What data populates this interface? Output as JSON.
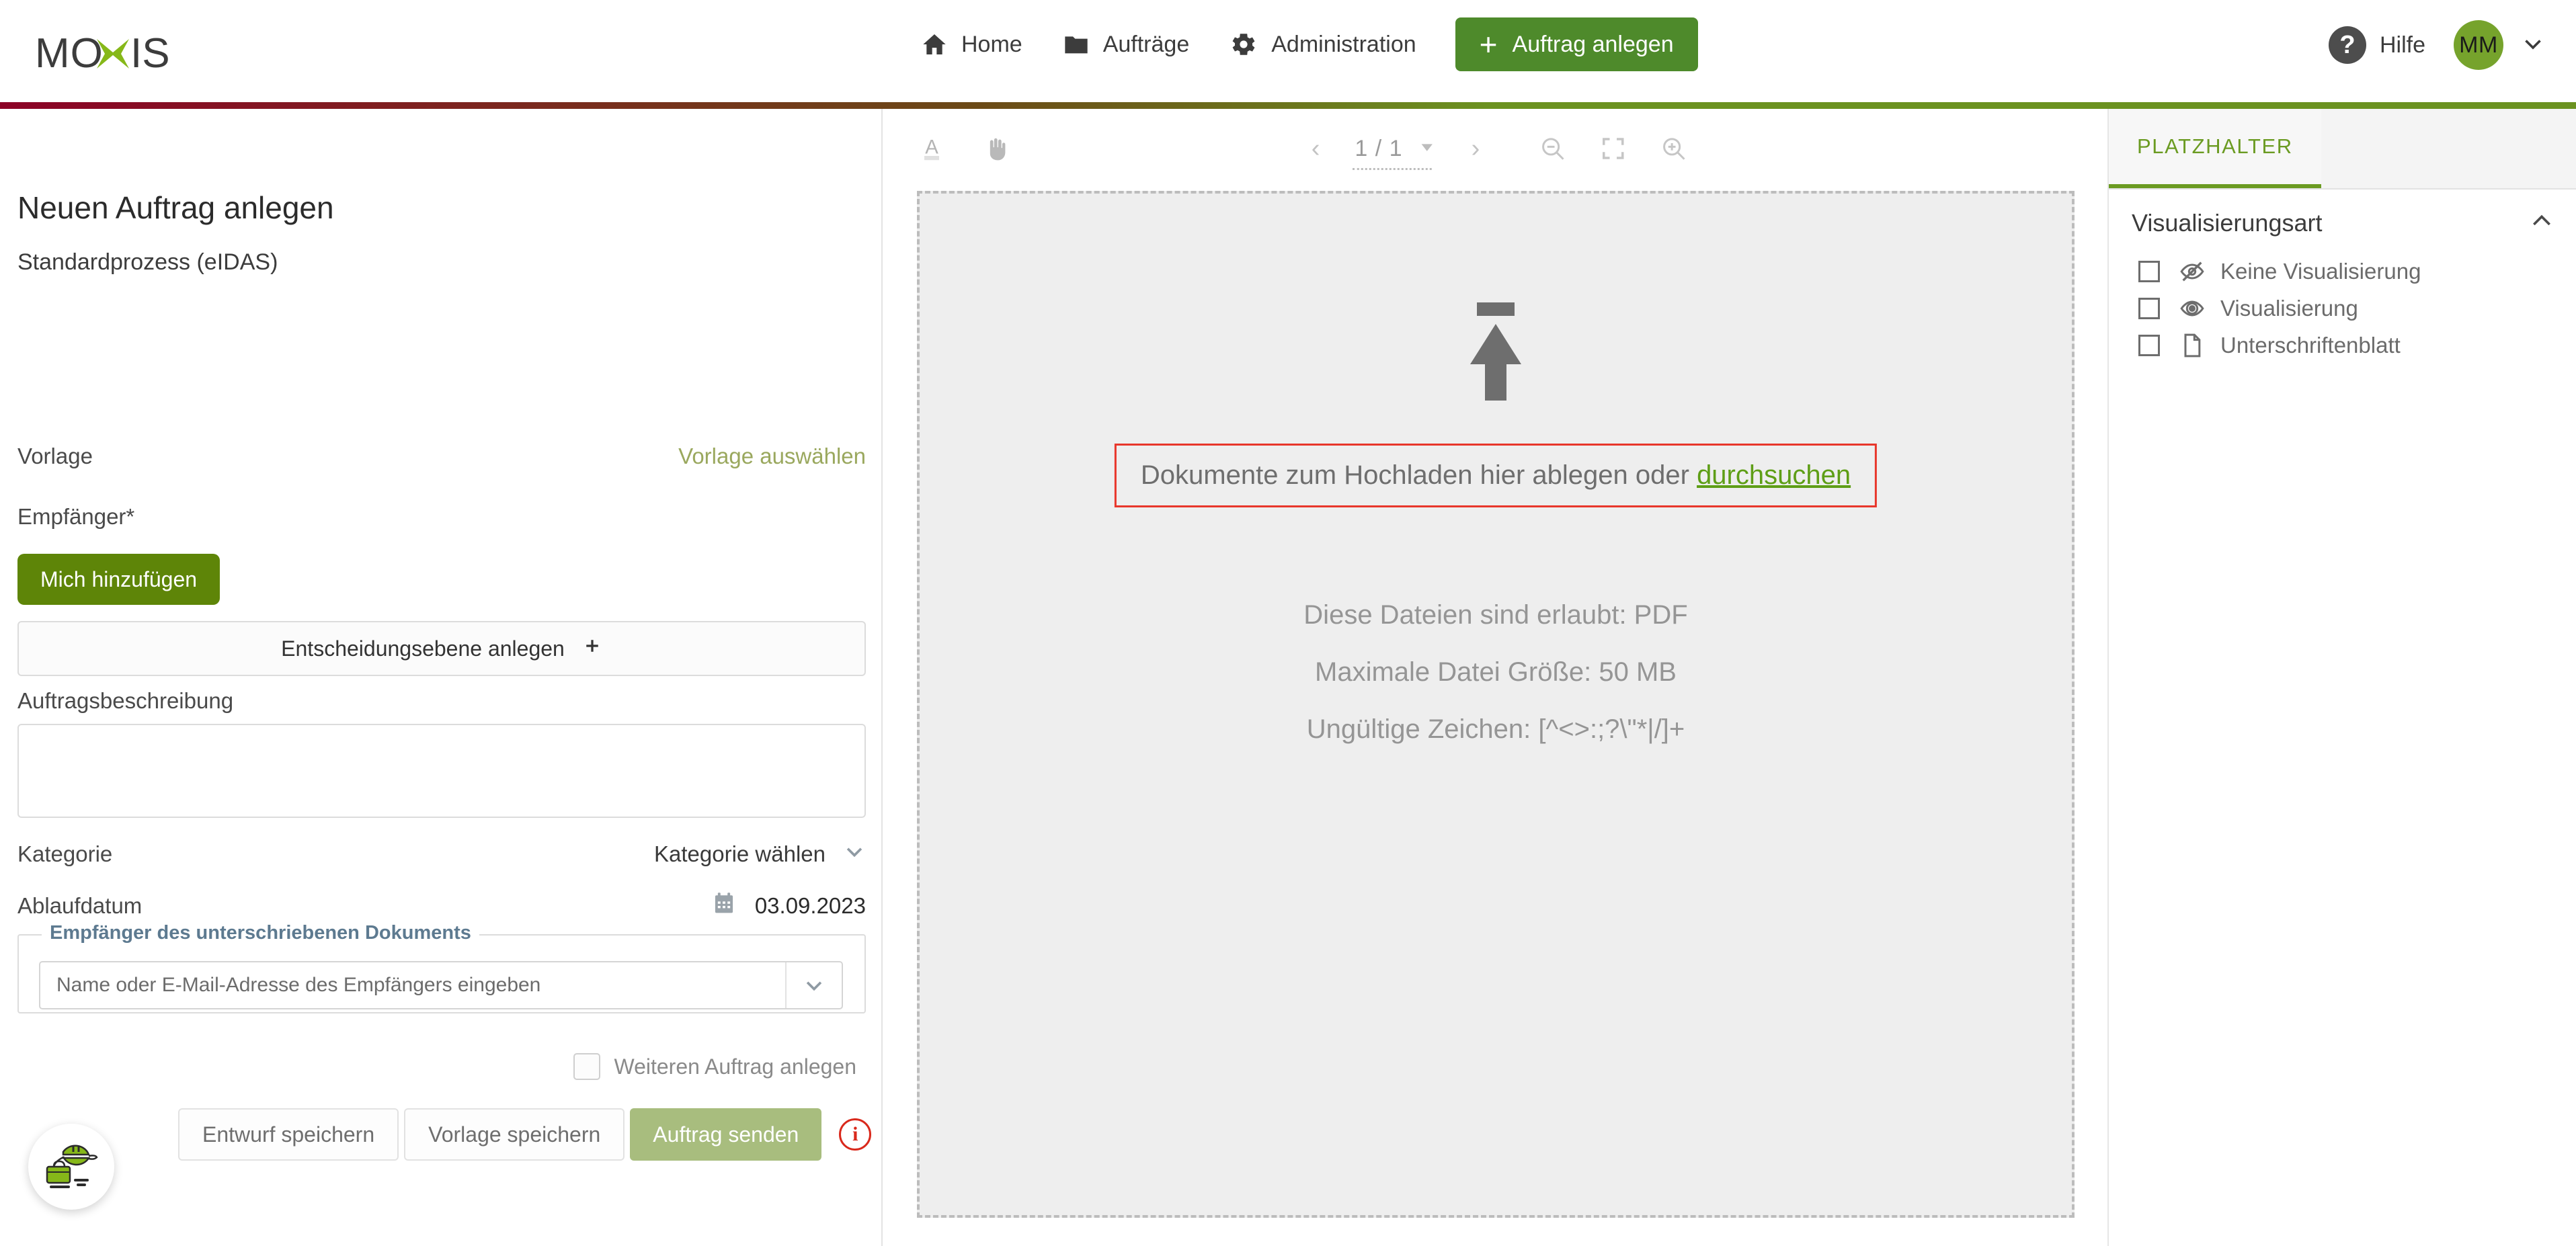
{
  "brand": {
    "name": "MOXIS",
    "accent_green": "#76a32c",
    "rule_from": "#8c0226",
    "rule_to": "#6b9220"
  },
  "header": {
    "nav": [
      {
        "label": "Home",
        "icon": "home-icon"
      },
      {
        "label": "Aufträge",
        "icon": "folder-icon"
      },
      {
        "label": "Administration",
        "icon": "gear-icon"
      }
    ],
    "create_button": {
      "label": "Auftrag anlegen",
      "icon": "plus-icon"
    },
    "help": {
      "label": "Hilfe",
      "icon": "question-mark-icon"
    },
    "avatar": {
      "initials": "MM"
    }
  },
  "form": {
    "title": "Neuen Auftrag anlegen",
    "process": "Standardprozess (eIDAS)",
    "vorlage": {
      "label": "Vorlage",
      "action": "Vorlage auswählen"
    },
    "empfaenger": {
      "label": "Empfänger*"
    },
    "add_me_button": "Mich hinzufügen",
    "decision_level_button": "Entscheidungsebene anlegen",
    "description": {
      "label": "Auftragsbeschreibung",
      "value": ""
    },
    "kategorie": {
      "label": "Kategorie",
      "value": "Kategorie wählen"
    },
    "ablaufdatum": {
      "label": "Ablaufdatum",
      "value": "03.09.2023"
    },
    "recipient_fieldset": {
      "legend": "Empfänger des unterschriebenen Dokuments",
      "placeholder": "Name oder E-Mail-Adresse des Empfängers eingeben",
      "value": ""
    },
    "more_order": {
      "label": "Weiteren Auftrag anlegen",
      "checked": false
    },
    "buttons": {
      "save_draft": "Entwurf speichern",
      "save_template": "Vorlage speichern",
      "send": "Auftrag senden"
    },
    "info_icon_glyph": "i"
  },
  "viewer": {
    "tools": {
      "text_select": "text-select-icon",
      "pan": "hand-icon",
      "prev": "‹",
      "next": "›",
      "page_indicator": "1 / 1",
      "zoom_out": "zoom-out-icon",
      "fit_screen": "fit-screen-icon",
      "zoom_in": "zoom-in-icon"
    },
    "dropzone": {
      "text_prefix": "Dokumente zum Hochladen hier ablegen oder ",
      "browse_link": "durchsuchen",
      "restrictions": [
        "Diese Dateien sind erlaubt: PDF",
        "Maximale Datei Größe: 50 MB",
        "Ungültige Zeichen: [^<>:;?\\\"*|/]+"
      ],
      "highlight_color": "#e8362b"
    }
  },
  "right_panel": {
    "tabs": [
      {
        "label": "PLATZHALTER",
        "active": true
      }
    ],
    "section": {
      "title": "Visualisierungsart",
      "collapse_icon": "chevron-up-icon"
    },
    "options": [
      {
        "label": "Keine Visualisierung",
        "icon": "eye-off-icon",
        "checked": false
      },
      {
        "label": "Visualisierung",
        "icon": "eye-icon",
        "checked": false
      },
      {
        "label": "Unterschriftenblatt",
        "icon": "document-icon",
        "checked": false
      }
    ]
  },
  "chat_widget": {
    "name": "support-mascot"
  }
}
